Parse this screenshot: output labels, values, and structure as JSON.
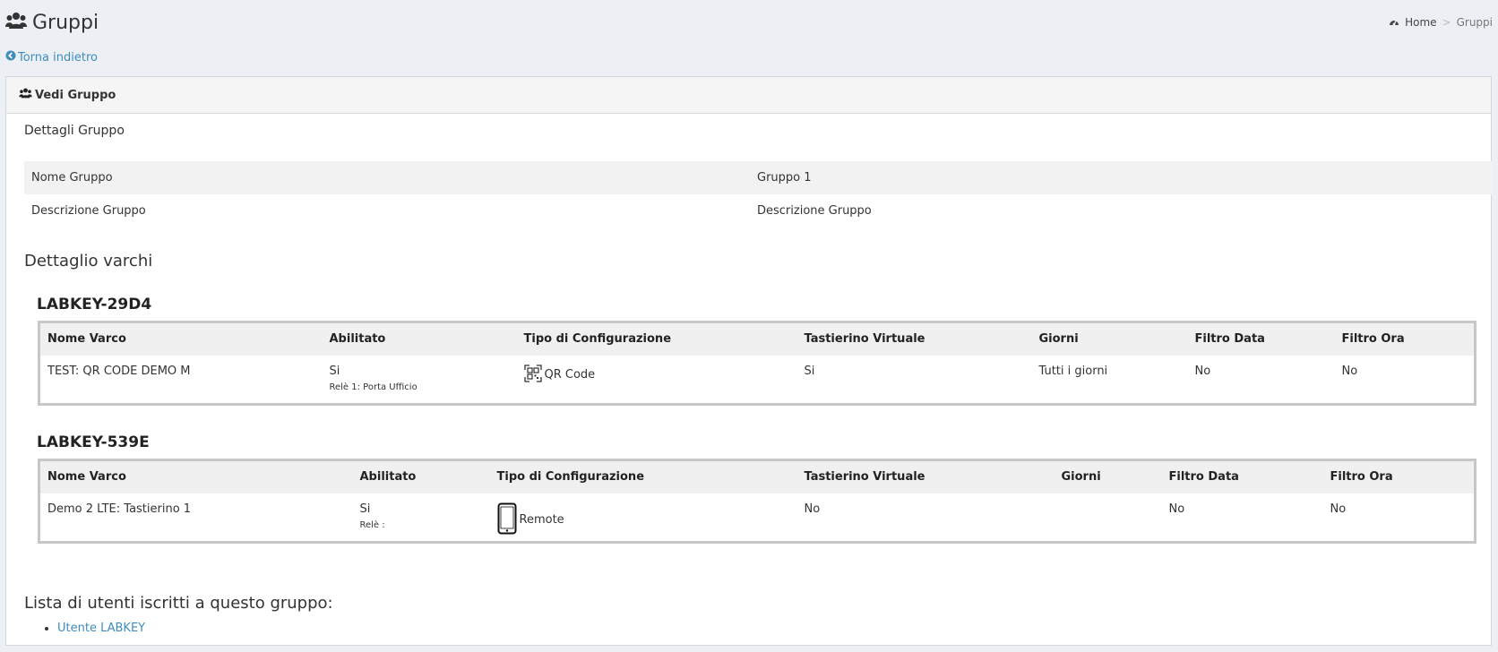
{
  "header": {
    "title": "Gruppi"
  },
  "breadcrumb": {
    "home": "Home",
    "current": "Gruppi"
  },
  "back_link": "Torna indietro",
  "box": {
    "title": "Vedi Gruppo",
    "details_title": "Dettagli Gruppo",
    "details": [
      {
        "label": "Nome Gruppo",
        "value": "Gruppo 1"
      },
      {
        "label": "Descrizione Gruppo",
        "value": "Descrizione Gruppo"
      }
    ],
    "varchi_title": "Dettaglio varchi",
    "columns": [
      "Nome Varco",
      "Abilitato",
      "Tipo di Configurazione",
      "Tastierino Virtuale",
      "Giorni",
      "Filtro Data",
      "Filtro Ora"
    ],
    "varchi": [
      {
        "device": "LABKEY-29D4",
        "row": {
          "nome": "TEST: QR CODE DEMO M",
          "abilitato": "Si",
          "rele": "Relè 1: Porta Ufficio",
          "config": "QR Code",
          "config_icon": "qr-code-icon",
          "tastierino": "Si",
          "giorni": "Tutti i giorni",
          "filtro_data": "No",
          "filtro_ora": "No"
        }
      },
      {
        "device": "LABKEY-539E",
        "row": {
          "nome": "Demo 2 LTE: Tastierino 1",
          "abilitato": "Si",
          "rele": "Relè :",
          "config": "Remote",
          "config_icon": "smartphone-icon",
          "tastierino": "No",
          "giorni": "",
          "filtro_data": "No",
          "filtro_ora": "No"
        }
      }
    ],
    "users_title": "Lista di utenti iscritti a questo gruppo:",
    "users": [
      "Utente LABKEY"
    ]
  }
}
